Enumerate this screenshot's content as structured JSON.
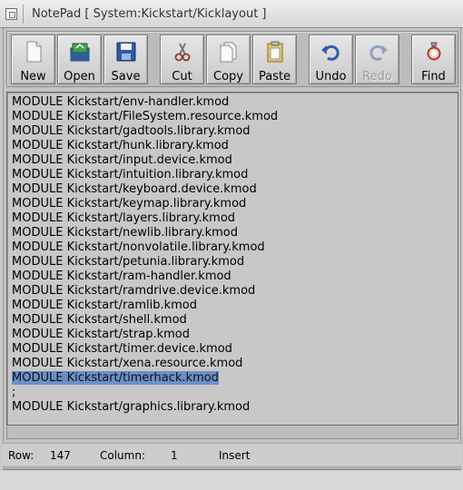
{
  "window": {
    "title": "NotePad [ System:Kickstart/Kicklayout ]"
  },
  "toolbar": {
    "buttons": [
      {
        "label": "New",
        "icon": "new-document-icon",
        "enabled": true
      },
      {
        "label": "Open",
        "icon": "open-folder-icon",
        "enabled": true
      },
      {
        "label": "Save",
        "icon": "save-disk-icon",
        "enabled": true
      },
      {
        "label": "Cut",
        "icon": "scissors-icon",
        "enabled": true
      },
      {
        "label": "Copy",
        "icon": "copy-icon",
        "enabled": true
      },
      {
        "label": "Paste",
        "icon": "paste-clipboard-icon",
        "enabled": true
      },
      {
        "label": "Undo",
        "icon": "undo-arrow-icon",
        "enabled": true
      },
      {
        "label": "Redo",
        "icon": "redo-arrow-icon",
        "enabled": false
      },
      {
        "label": "Find",
        "icon": "find-icon",
        "enabled": true
      }
    ]
  },
  "editor": {
    "lines": [
      "MODULE Kickstart/env-handler.kmod",
      "MODULE Kickstart/FileSystem.resource.kmod",
      "MODULE Kickstart/gadtools.library.kmod",
      "MODULE Kickstart/hunk.library.kmod",
      "MODULE Kickstart/input.device.kmod",
      "MODULE Kickstart/intuition.library.kmod",
      "MODULE Kickstart/keyboard.device.kmod",
      "MODULE Kickstart/keymap.library.kmod",
      "MODULE Kickstart/layers.library.kmod",
      "MODULE Kickstart/newlib.library.kmod",
      "MODULE Kickstart/nonvolatile.library.kmod",
      "MODULE Kickstart/petunia.library.kmod",
      "MODULE Kickstart/ram-handler.kmod",
      "MODULE Kickstart/ramdrive.device.kmod",
      "MODULE Kickstart/ramlib.kmod",
      "MODULE Kickstart/shell.kmod",
      "MODULE Kickstart/strap.kmod",
      "MODULE Kickstart/timer.device.kmod",
      "MODULE Kickstart/xena.resource.kmod",
      "MODULE Kickstart/timerhack.kmod",
      ";",
      "MODULE Kickstart/graphics.library.kmod"
    ],
    "selected_line_index": 19,
    "selection_color": "#6b8fc8"
  },
  "status": {
    "row_label": "Row:",
    "row_value": "147",
    "column_label": "Column:",
    "column_value": "1",
    "mode": "Insert"
  }
}
